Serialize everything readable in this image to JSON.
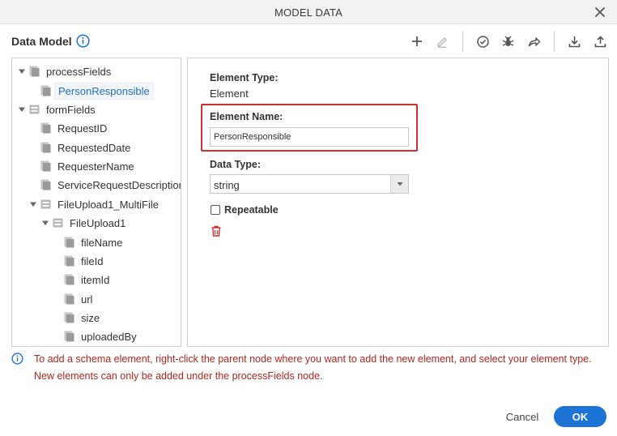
{
  "window": {
    "title": "MODEL DATA"
  },
  "header": {
    "title": "Data Model"
  },
  "tree": {
    "nodes": [
      {
        "label": "processFields"
      },
      {
        "label": "PersonResponsible"
      },
      {
        "label": "formFields"
      },
      {
        "label": "RequestID"
      },
      {
        "label": "RequestedDate"
      },
      {
        "label": "RequesterName"
      },
      {
        "label": "ServiceRequestDescription"
      },
      {
        "label": "FileUpload1_MultiFile"
      },
      {
        "label": "FileUpload1"
      },
      {
        "label": "fileName"
      },
      {
        "label": "fileId"
      },
      {
        "label": "itemId"
      },
      {
        "label": "url"
      },
      {
        "label": "size"
      },
      {
        "label": "uploadedBy"
      }
    ]
  },
  "details": {
    "element_type_label": "Element Type:",
    "element_type_value": "Element",
    "element_name_label": "Element Name:",
    "element_name_value": "PersonResponsible",
    "data_type_label": "Data Type:",
    "data_type_value": "string",
    "repeatable_label": "Repeatable",
    "repeatable_checked": false
  },
  "message": {
    "line1": "To add a schema element, right-click the parent node where you want to add the new element, and select your element type.",
    "line2": "New elements can only be added under the processFields node."
  },
  "footer": {
    "cancel_label": "Cancel",
    "ok_label": "OK"
  },
  "colors": {
    "accent": "#1e73d6",
    "highlight": "#d32f2f",
    "message_text": "#b3261e",
    "selected_text": "#1f6fc4"
  }
}
